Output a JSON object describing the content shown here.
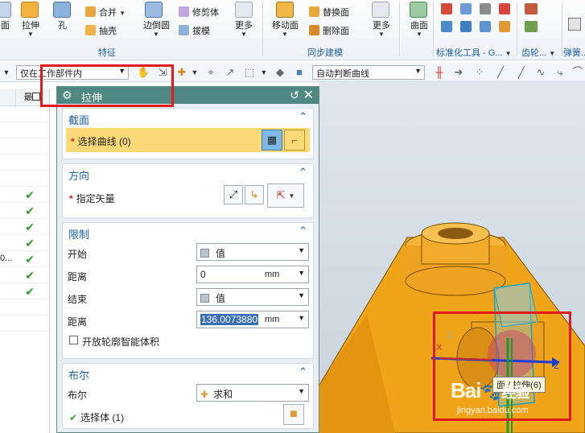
{
  "ribbon": {
    "items": [
      {
        "label": "平面"
      },
      {
        "label": "拉伸"
      },
      {
        "label": "孔"
      },
      {
        "label": "合并"
      },
      {
        "label": "抽壳"
      },
      {
        "label": "边倒圆"
      },
      {
        "label": "修剪体"
      },
      {
        "label": "拔模"
      },
      {
        "label": "更多"
      },
      {
        "label": "移动面"
      },
      {
        "label": "替换面"
      },
      {
        "label": "删除面"
      },
      {
        "label": "更多"
      },
      {
        "label": "曲面"
      }
    ],
    "groups": [
      "特征",
      "同步建模",
      "标准化工具 - G...",
      "齿轮...",
      "弹簧..."
    ]
  },
  "toolbar": {
    "scope_combo": "仅在工作部件内",
    "curve_rule_combo": "自动判断曲线"
  },
  "nav": {
    "column_header": "最新",
    "truncated_text": "0..."
  },
  "dialog": {
    "title": "拉伸",
    "sections": {
      "section": {
        "title": "截面",
        "select_curve": "选择曲线 (0)"
      },
      "direction": {
        "title": "方向",
        "specify_vector": "指定矢量"
      },
      "limits": {
        "title": "限制",
        "start_label": "开始",
        "start_value": "值",
        "distance1_label": "距离",
        "distance1_value": "0",
        "distance1_unit": "mm",
        "end_label": "结束",
        "end_value": "值",
        "distance2_label": "距离",
        "distance2_value": "136.0073880",
        "distance2_unit": "mm",
        "open_profile": "开放轮廓智能体积"
      },
      "boolean": {
        "title": "布尔",
        "boolean_label": "布尔",
        "boolean_value": "求和",
        "select_body": "选择体 (1)"
      }
    }
  },
  "viewport": {
    "axis_z": "Z",
    "axis_x": "X",
    "tooltip": "面 / 拉伸(6)"
  },
  "watermark": {
    "brand": "Bai",
    "brand2": "经验",
    "url": "jingyan.baidu.com"
  },
  "colors": {
    "dialog_title_bg": "#4f8782",
    "selection_highlight": "#fbd977",
    "model_orange": "#f2a81d",
    "highlight_red": "#e01b1b"
  }
}
